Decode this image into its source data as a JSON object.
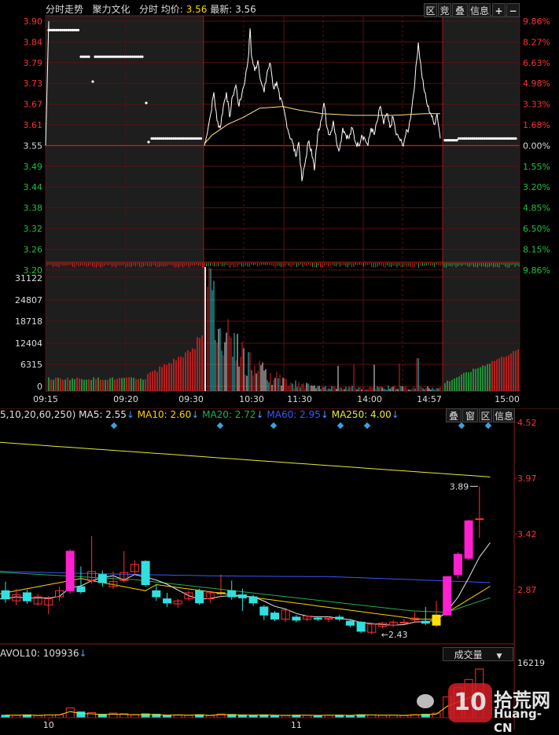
{
  "intraday": {
    "title": "分时走势",
    "stock_name": "聚力文化",
    "mode": "分时",
    "avg_label": "均价:",
    "avg_value": "3.56",
    "latest_label": "最新:",
    "latest_value": "3.56",
    "buttons": [
      "区",
      "竞",
      "叠",
      "信息"
    ],
    "price_labels": [
      "3.90",
      "3.84",
      "3.79",
      "3.73",
      "3.67",
      "3.61",
      "3.55",
      "3.49",
      "3.44",
      "3.38",
      "3.32",
      "3.26",
      "3.20"
    ],
    "pct_labels": [
      "9.86%",
      "8.27%",
      "6.63%",
      "4.98%",
      "3.33%",
      "1.68%",
      "0.00%",
      "1.55%",
      "3.20%",
      "4.85%",
      "6.50%",
      "8.15%",
      "9.86%"
    ],
    "volume_labels": [
      "31122",
      "24807",
      "18718",
      "12404",
      "6315",
      "0"
    ],
    "time_labels": [
      "09:15",
      "09:20",
      "09:30",
      "10:30",
      "11:30",
      "14:00",
      "14:57",
      "15:00"
    ]
  },
  "kline": {
    "ma_prefix": "5,10,20,60,250)",
    "ma": [
      {
        "label": "MA5: 2.55",
        "color": "#e6e6e6"
      },
      {
        "label": "MA10: 2.60",
        "color": "#ffd400"
      },
      {
        "label": "MA20: 2.72",
        "color": "#20b050"
      },
      {
        "label": "MA60: 2.95",
        "color": "#3a56ff"
      },
      {
        "label": "MA250: 4.00",
        "color": "#e8e840"
      }
    ],
    "buttons": [
      "叠",
      "窗",
      "区",
      "信息"
    ],
    "price_labels": [
      "4.52",
      "3.97",
      "3.42",
      "2.87"
    ],
    "high_mark": "3.89",
    "low_mark": "2.43",
    "candles": [
      {
        "o": 2.86,
        "c": 2.78,
        "h": 2.95,
        "l": 2.74
      },
      {
        "o": 2.76,
        "c": 2.82,
        "h": 2.88,
        "l": 2.72
      },
      {
        "o": 2.84,
        "c": 2.76,
        "h": 2.87,
        "l": 2.73
      },
      {
        "o": 2.73,
        "c": 2.8,
        "h": 2.83,
        "l": 2.71
      },
      {
        "o": 2.72,
        "c": 2.78,
        "h": 2.81,
        "l": 2.63
      },
      {
        "o": 2.8,
        "c": 2.86,
        "h": 2.9,
        "l": 2.76
      },
      {
        "o": 2.86,
        "c": 3.25,
        "h": 3.27,
        "l": 2.83
      },
      {
        "o": 2.9,
        "c": 2.85,
        "h": 3.1,
        "l": 2.83
      },
      {
        "o": 2.96,
        "c": 3.05,
        "h": 3.4,
        "l": 2.93
      },
      {
        "o": 3.02,
        "c": 2.94,
        "h": 3.06,
        "l": 2.9
      },
      {
        "o": 2.9,
        "c": 2.95,
        "h": 3.05,
        "l": 2.88
      },
      {
        "o": 2.96,
        "c": 3.04,
        "h": 3.25,
        "l": 2.94
      },
      {
        "o": 3.05,
        "c": 3.12,
        "h": 3.16,
        "l": 3.02
      },
      {
        "o": 3.15,
        "c": 2.92,
        "h": 3.16,
        "l": 2.9
      },
      {
        "o": 2.86,
        "c": 2.8,
        "h": 2.92,
        "l": 2.76
      },
      {
        "o": 2.78,
        "c": 2.74,
        "h": 2.84,
        "l": 2.7
      },
      {
        "o": 2.73,
        "c": 2.76,
        "h": 2.78,
        "l": 2.69
      },
      {
        "o": 2.78,
        "c": 2.84,
        "h": 2.86,
        "l": 2.76
      },
      {
        "o": 2.86,
        "c": 2.74,
        "h": 2.88,
        "l": 2.72
      },
      {
        "o": 2.78,
        "c": 2.84,
        "h": 2.86,
        "l": 2.74
      },
      {
        "o": 2.84,
        "c": 2.84,
        "h": 3.02,
        "l": 2.8
      },
      {
        "o": 2.86,
        "c": 2.8,
        "h": 2.96,
        "l": 2.77
      },
      {
        "o": 2.82,
        "c": 2.79,
        "h": 2.88,
        "l": 2.66
      },
      {
        "o": 2.8,
        "c": 2.74,
        "h": 2.82,
        "l": 2.71
      },
      {
        "o": 2.7,
        "c": 2.62,
        "h": 2.72,
        "l": 2.57
      },
      {
        "o": 2.64,
        "c": 2.58,
        "h": 2.66,
        "l": 2.56
      },
      {
        "o": 2.58,
        "c": 2.67,
        "h": 2.68,
        "l": 2.55
      },
      {
        "o": 2.6,
        "c": 2.57,
        "h": 2.62,
        "l": 2.55
      },
      {
        "o": 2.58,
        "c": 2.61,
        "h": 2.62,
        "l": 2.56
      },
      {
        "o": 2.59,
        "c": 2.58,
        "h": 2.61,
        "l": 2.56
      },
      {
        "o": 2.58,
        "c": 2.59,
        "h": 2.61,
        "l": 2.55
      },
      {
        "o": 2.6,
        "c": 2.58,
        "h": 2.62,
        "l": 2.56
      },
      {
        "o": 2.56,
        "c": 2.52,
        "h": 2.58,
        "l": 2.5
      },
      {
        "o": 2.55,
        "c": 2.46,
        "h": 2.56,
        "l": 2.44
      },
      {
        "o": 2.45,
        "c": 2.53,
        "h": 2.55,
        "l": 2.43
      },
      {
        "o": 2.51,
        "c": 2.54,
        "h": 2.55,
        "l": 2.49
      },
      {
        "o": 2.52,
        "c": 2.55,
        "h": 2.57,
        "l": 2.5
      },
      {
        "o": 2.55,
        "c": 2.55,
        "h": 2.58,
        "l": 2.53
      },
      {
        "o": 2.57,
        "c": 2.59,
        "h": 2.65,
        "l": 2.55
      },
      {
        "o": 2.56,
        "c": 2.54,
        "h": 2.7,
        "l": 2.52
      },
      {
        "o": 2.52,
        "c": 2.62,
        "h": 2.76,
        "l": 2.5
      },
      {
        "o": 2.62,
        "c": 3.0,
        "h": 3.0,
        "l": 2.62
      },
      {
        "o": 3.02,
        "c": 3.22,
        "h": 3.24,
        "l": 2.98
      },
      {
        "o": 3.18,
        "c": 3.55,
        "h": 3.56,
        "l": 3.16
      },
      {
        "o": 3.57,
        "c": 3.57,
        "h": 3.89,
        "l": 3.38
      }
    ],
    "volume_title": "AVOL10: 109936",
    "volume_dropdown": "成交量",
    "volume_labels": [
      "16219"
    ],
    "volumes": [
      22,
      20,
      25,
      18,
      24,
      26,
      85,
      50,
      45,
      30,
      40,
      35,
      28,
      33,
      30,
      22,
      25,
      20,
      26,
      18,
      32,
      28,
      24,
      22,
      25,
      20,
      18,
      22,
      20,
      18,
      20,
      22,
      18,
      26,
      24,
      20,
      22,
      18,
      26,
      30,
      40,
      180,
      260,
      330,
      420
    ],
    "date_labels": [
      "10",
      "11"
    ]
  },
  "watermark": {
    "text": "拾荒网",
    "domain": "Huang-CN"
  }
}
